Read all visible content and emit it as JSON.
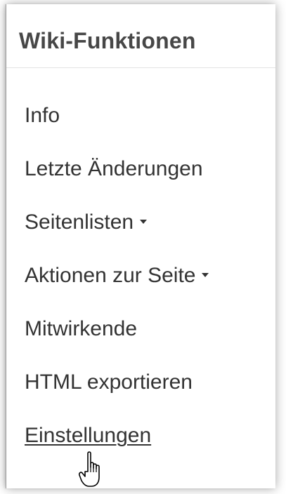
{
  "panel": {
    "title": "Wiki-Funktionen",
    "items": [
      {
        "label": "Info"
      },
      {
        "label": "Letzte Änderungen"
      },
      {
        "label": "Seitenlisten"
      },
      {
        "label": "Aktionen zur Seite"
      },
      {
        "label": "Mitwirkende"
      },
      {
        "label": "HTML exportieren"
      },
      {
        "label": "Einstellungen"
      }
    ]
  },
  "icons": {
    "dropdown_caret": "caret-down-icon",
    "cursor": "hand-pointer-icon"
  },
  "colors": {
    "text": "#333333",
    "title": "#474747",
    "divider": "#e3e3e3"
  }
}
